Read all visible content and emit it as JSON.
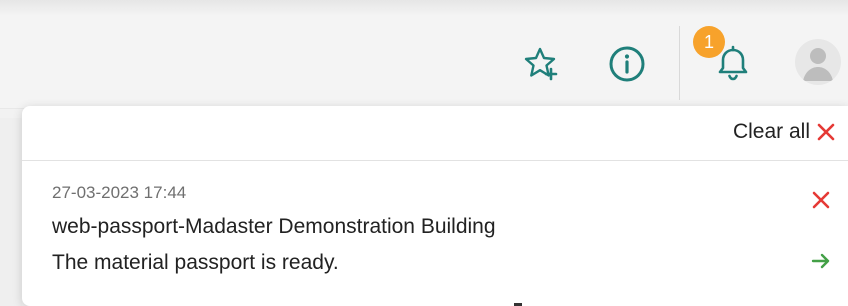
{
  "header": {
    "notification_count": "1",
    "icons": [
      "star-add-icon",
      "info-icon",
      "bell-icon",
      "user-avatar-icon"
    ]
  },
  "notifications_panel": {
    "clear_all_label": "Clear all",
    "items": [
      {
        "date": "27-03-2023 17:44",
        "title": "web-passport-Madaster Demonstration Building",
        "message": "The material passport is ready."
      }
    ]
  },
  "colors": {
    "accent_teal": "#1f7f7a",
    "badge_orange": "#f7a22b",
    "danger_red": "#e53935",
    "success_green": "#43a047"
  }
}
